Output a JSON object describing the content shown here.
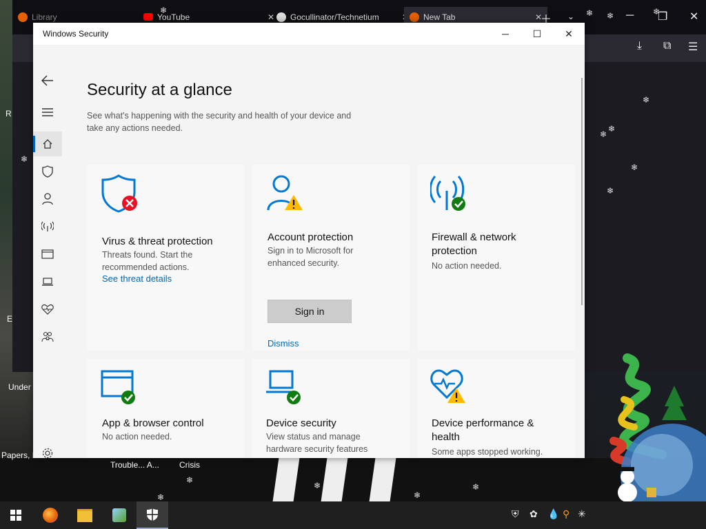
{
  "browser": {
    "tabs": [
      {
        "label": "Library"
      },
      {
        "label": "YouTube"
      },
      {
        "label": "Gocullinator/Technetium"
      },
      {
        "label": "New Tab"
      }
    ]
  },
  "desktop": {
    "icon_labels": [
      "R",
      "E",
      "Under",
      "Papers, P",
      "Trouble... A...",
      "Crisis"
    ]
  },
  "window": {
    "title": "Windows Security",
    "minimize": "─",
    "maximize": "☐",
    "close": "✕"
  },
  "main": {
    "heading": "Security at a glance",
    "subheading": "See what's happening with the security and health of your device and take any actions needed."
  },
  "cards": [
    {
      "title": "Virus & threat protection",
      "desc": "Threats found. Start the recommended actions.",
      "link": "See threat details",
      "status": "error",
      "icon": "shield-icon"
    },
    {
      "title": "Account protection",
      "desc": "Sign in to Microsoft for enhanced security.",
      "button": "Sign in",
      "link": "Dismiss",
      "status": "warning",
      "icon": "person-icon"
    },
    {
      "title": "Firewall & network protection",
      "desc": "No action needed.",
      "status": "ok",
      "icon": "antenna-icon"
    },
    {
      "title": "App & browser control",
      "desc": "No action needed.",
      "status": "ok",
      "icon": "browser-window-icon"
    },
    {
      "title": "Device security",
      "desc": "View status and manage hardware security features",
      "status": "ok",
      "icon": "laptop-icon"
    },
    {
      "title": "Device performance & health",
      "desc": "Some apps stopped working.",
      "status": "warning",
      "icon": "heart-pulse-icon"
    }
  ],
  "colors": {
    "accent": "#0067c0",
    "icon_blue": "#0078d4",
    "ok": "#107c10",
    "warning": "#ffb900",
    "error": "#e81123"
  }
}
